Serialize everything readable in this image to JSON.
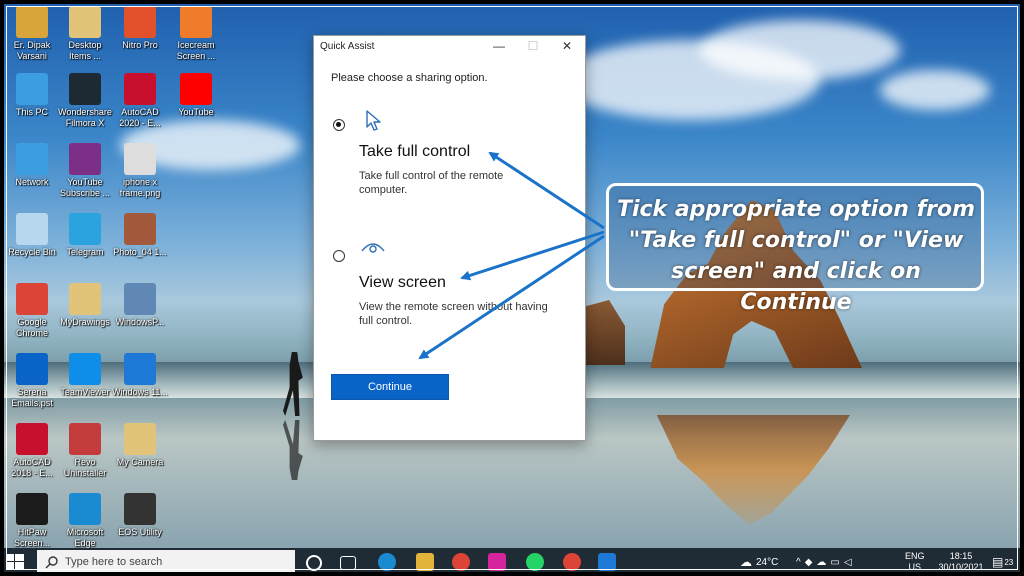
{
  "desktop": {
    "icons": [
      {
        "label": "Er. Dipak Varsani",
        "icon": "user-folder-icon",
        "color": "#d9a43a"
      },
      {
        "label": "Desktop Items ...",
        "icon": "folder-icon",
        "color": "#e2c37a"
      },
      {
        "label": "Nitro Pro",
        "icon": "nitro-pro-icon",
        "color": "#e2502c"
      },
      {
        "label": "Icecream Screen ...",
        "icon": "icecream-icon",
        "color": "#f07b2a"
      },
      {
        "label": "This PC",
        "icon": "computer-icon",
        "color": "#3c9de0"
      },
      {
        "label": "Wondershare Filmora X",
        "icon": "filmora-icon",
        "color": "#1e2a33"
      },
      {
        "label": "AutoCAD 2020 - E...",
        "icon": "autocad-icon",
        "color": "#c8102e"
      },
      {
        "label": "YouTube",
        "icon": "youtube-icon",
        "color": "#ff0000"
      },
      {
        "label": "Network",
        "icon": "network-icon",
        "color": "#3c9de0"
      },
      {
        "label": "YouTube Subscribe ...",
        "icon": "winrar-icon",
        "color": "#7b2f86"
      },
      {
        "label": "iphone x frame.png",
        "icon": "image-file-icon",
        "color": "#dddddd"
      },
      {
        "label": "Recycle Bin",
        "icon": "recycle-bin-icon",
        "color": "#b7d7ee"
      },
      {
        "label": "Telegram",
        "icon": "telegram-icon",
        "color": "#2aa3df"
      },
      {
        "label": "Photo_04 1...",
        "icon": "photo-icon",
        "color": "#a35a3c"
      },
      {
        "label": "Google Chrome",
        "icon": "chrome-icon",
        "color": "#db4437"
      },
      {
        "label": "MyDrawings",
        "icon": "folder-icon",
        "color": "#e2c37a"
      },
      {
        "label": "WindowsP...",
        "icon": "windows-setup-icon",
        "color": "#5f88b5"
      },
      {
        "label": "Serena Emails.pst",
        "icon": "outlook-file-icon",
        "color": "#0a64c8"
      },
      {
        "label": "TeamViewer",
        "icon": "teamviewer-icon",
        "color": "#0e8ee9"
      },
      {
        "label": "Windows 11...",
        "icon": "windows-icon",
        "color": "#1e78d6"
      },
      {
        "label": "AutoCAD 2018 - E...",
        "icon": "autocad-icon",
        "color": "#c8102e"
      },
      {
        "label": "Revo Uninstaller",
        "icon": "revo-uninstaller-icon",
        "color": "#c43b3b"
      },
      {
        "label": "My Camera",
        "icon": "folder-icon",
        "color": "#e2c37a"
      },
      {
        "label": "HitPaw Screen...",
        "icon": "hitpaw-icon",
        "color": "#1b1b1b"
      },
      {
        "label": "Microsoft Edge",
        "icon": "edge-icon",
        "color": "#1a8bd1"
      },
      {
        "label": "EOS Utility",
        "icon": "eos-utility-icon",
        "color": "#333333"
      }
    ]
  },
  "quick_assist": {
    "title": "Quick Assist",
    "prompt": "Please choose a sharing option.",
    "options": [
      {
        "title": "Take full control",
        "description": "Take full control of the remote computer.",
        "selected": true,
        "icon": "cursor-icon"
      },
      {
        "title": "View screen",
        "description": "View the remote screen without having full control.",
        "selected": false,
        "icon": "eye-icon"
      }
    ],
    "continue_label": "Continue",
    "window_controls": {
      "minimize": "—",
      "maximize": "☐",
      "close": "✕"
    }
  },
  "callout": {
    "text": "Tick appropriate option from \"Take full control\" or \"View screen\" and click on Continue"
  },
  "taskbar": {
    "search_placeholder": "Type here to search",
    "weather": "24°C",
    "language": "ENG",
    "region": "US",
    "time": "18:15",
    "date": "30/10/2021",
    "notification_count": "23",
    "pinned": [
      {
        "icon": "task-view-icon",
        "color": "#1f2b35"
      },
      {
        "icon": "edge-icon",
        "color": "#1a8bd1"
      },
      {
        "icon": "file-explorer-icon",
        "color": "#e2b43a"
      },
      {
        "icon": "chrome-icon",
        "color": "#db4437"
      },
      {
        "icon": "instagram-icon",
        "color": "#d6249f"
      },
      {
        "icon": "whatsapp-icon",
        "color": "#25d366"
      },
      {
        "icon": "chrome-icon",
        "color": "#db4437"
      },
      {
        "icon": "quick-assist-icon",
        "color": "#1e78d6"
      }
    ]
  },
  "colors": {
    "accent": "#0a64c8",
    "arrow": "#1a73c9"
  }
}
